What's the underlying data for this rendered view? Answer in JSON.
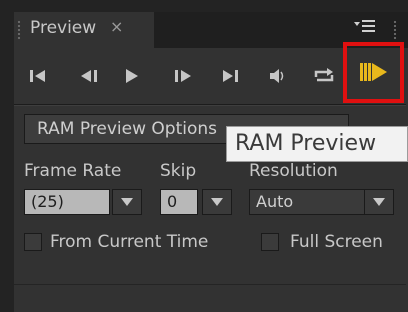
{
  "panel": {
    "tab_label": "Preview",
    "tab_close": "×",
    "menu_icon": "panel-menu-icon"
  },
  "transport": {
    "buttons": [
      "first-frame-icon",
      "previous-frame-icon",
      "play-pause-icon",
      "next-frame-icon",
      "last-frame-icon",
      "mute-audio-icon",
      "loop-icon",
      "ram-preview-icon"
    ],
    "highlight_color": "#e01010",
    "ram_icon_color": "#e8b81c"
  },
  "options": {
    "dropdown_label": "RAM Preview Options",
    "tooltip": "RAM Preview"
  },
  "settings": {
    "frame_rate_label": "Frame Rate",
    "skip_label": "Skip",
    "resolution_label": "Resolution",
    "frame_rate_value": "(25)",
    "skip_value": "0",
    "resolution_value": "Auto"
  },
  "checkboxes": {
    "from_current_time": "From Current Time",
    "full_screen": "Full Screen"
  }
}
